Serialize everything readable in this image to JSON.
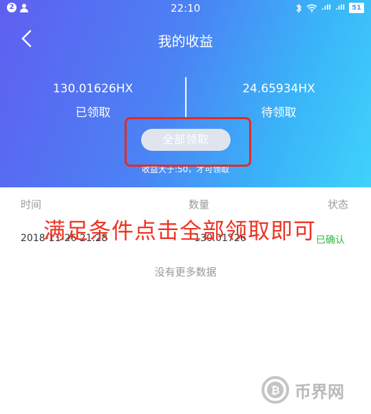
{
  "status_bar": {
    "notif_count": "2",
    "time": "22:10",
    "signal1": ".ıll",
    "signal2": ".ıll",
    "battery": "51"
  },
  "header": {
    "title": "我的收益"
  },
  "received": {
    "amount": "130.01626HX",
    "label": "已领取"
  },
  "pending": {
    "amount": "24.65934HX",
    "label": "待领取"
  },
  "claim_button": {
    "label": "全部领取"
  },
  "hint": {
    "text": "收益大于:50，才可领取"
  },
  "table": {
    "headers": [
      "时间",
      "数量",
      "状态"
    ],
    "rows": [
      {
        "time": "2018-11-26 21:28",
        "amount": "130.01726",
        "status": "已确认"
      }
    ]
  },
  "no_more": "没有更多数据",
  "annotation": "满足条件点击全部领取即可",
  "watermark": "币界网",
  "colors": {
    "accent_red": "#e42b1f",
    "status_green": "#2fb83e"
  }
}
